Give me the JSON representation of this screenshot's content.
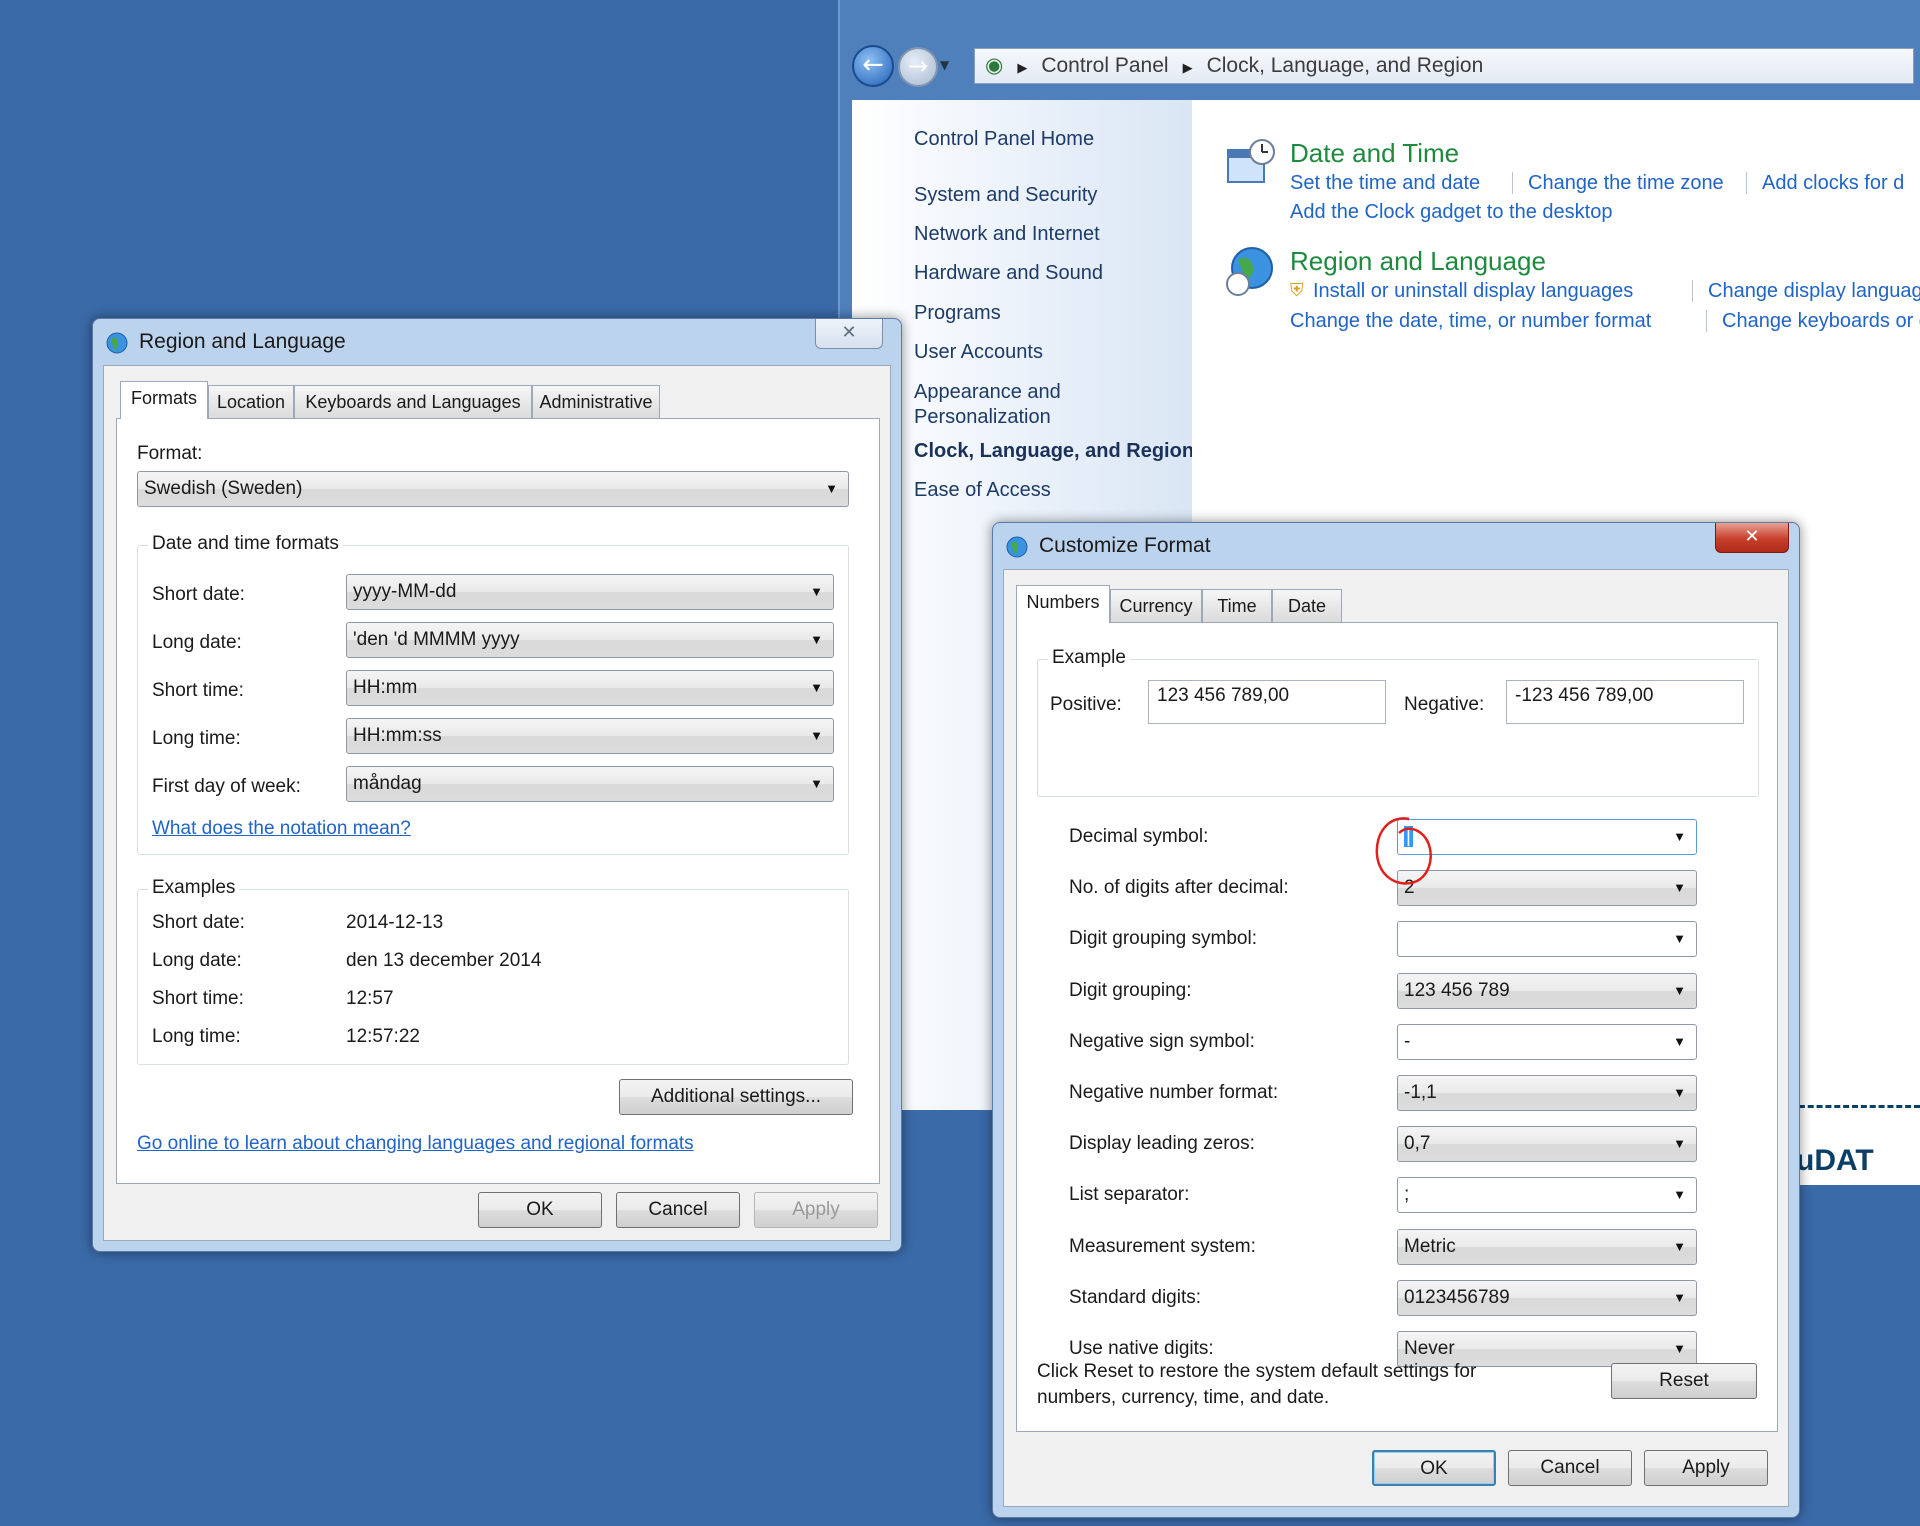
{
  "control_panel": {
    "breadcrumb": [
      "Control Panel",
      "Clock, Language, and Region"
    ],
    "sidebar": [
      {
        "label": "Control Panel Home"
      },
      {
        "label": "System and Security"
      },
      {
        "label": "Network and Internet"
      },
      {
        "label": "Hardware and Sound"
      },
      {
        "label": "Programs"
      },
      {
        "label": "User Accounts"
      },
      {
        "label": "Appearance and"
      },
      {
        "label": "Personalization"
      },
      {
        "label": "Clock, Language, and Region"
      },
      {
        "label": "Ease of Access"
      }
    ],
    "date_time": {
      "title": "Date and Time",
      "links": [
        "Set the time and date",
        "Change the time zone",
        "Add clocks for d",
        "Add the Clock gadget to the desktop"
      ]
    },
    "region_language": {
      "title": "Region and Language",
      "links": [
        "Install or uninstall display languages",
        "Change display language",
        "Change the date, time, or number format",
        "Change keyboards or o"
      ]
    }
  },
  "region_dialog": {
    "title": "Region and Language",
    "close_glyph": "✕",
    "tabs": [
      "Formats",
      "Location",
      "Keyboards and Languages",
      "Administrative"
    ],
    "format_label": "Format:",
    "format_value": "Swedish (Sweden)",
    "date_time_group": "Date and time formats",
    "fields": [
      {
        "label": "Short date:",
        "value": "yyyy-MM-dd"
      },
      {
        "label": "Long date:",
        "value": "'den 'd MMMM yyyy"
      },
      {
        "label": "Short time:",
        "value": "HH:mm"
      },
      {
        "label": "Long time:",
        "value": "HH:mm:ss"
      },
      {
        "label": "First day of week:",
        "value": "måndag"
      }
    ],
    "notation_link": "What does the notation mean?",
    "examples_group": "Examples",
    "examples": [
      {
        "label": "Short date:",
        "value": "2014-12-13"
      },
      {
        "label": "Long date:",
        "value": "den 13 december 2014"
      },
      {
        "label": "Short time:",
        "value": "12:57"
      },
      {
        "label": "Long time:",
        "value": "12:57:22"
      }
    ],
    "additional_button": "Additional settings...",
    "online_link": "Go online to learn about changing languages and regional formats",
    "ok": "OK",
    "cancel": "Cancel",
    "apply": "Apply"
  },
  "customize_dialog": {
    "title": "Customize Format",
    "close_glyph": "✕",
    "tabs": [
      "Numbers",
      "Currency",
      "Time",
      "Date"
    ],
    "example_group": "Example",
    "positive_label": "Positive:",
    "positive_value": "123 456 789,00",
    "negative_label": "Negative:",
    "negative_value": "-123 456 789,00",
    "settings": [
      {
        "label": "Decimal symbol:",
        "value": "|"
      },
      {
        "label": "No. of digits after decimal:",
        "value": "2"
      },
      {
        "label": "Digit grouping symbol:",
        "value": ""
      },
      {
        "label": "Digit grouping:",
        "value": "123 456 789"
      },
      {
        "label": "Negative sign symbol:",
        "value": "-"
      },
      {
        "label": "Negative number format:",
        "value": "-1,1"
      },
      {
        "label": "Display leading zeros:",
        "value": "0,7"
      },
      {
        "label": "List separator:",
        "value": ";"
      },
      {
        "label": "Measurement system:",
        "value": "Metric"
      },
      {
        "label": "Standard digits:",
        "value": "0123456789"
      },
      {
        "label": "Use native digits:",
        "value": "Never"
      }
    ],
    "reset_note_line1": "Click Reset to restore the system default settings for",
    "reset_note_line2": "numbers, currency, time, and date.",
    "reset": "Reset",
    "ok": "OK",
    "cancel": "Cancel",
    "apply": "Apply"
  },
  "background_fragment": "uDAT",
  "colors": {
    "desktop": "#3a6aa8",
    "link": "#1f64c6",
    "category_title": "#1e8a3e",
    "annotation": "#e0201a"
  }
}
